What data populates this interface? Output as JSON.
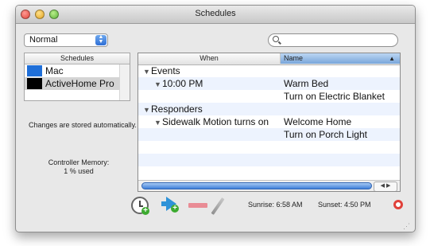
{
  "window": {
    "title": "Schedules"
  },
  "mode_popup": {
    "selected": "Normal"
  },
  "search": {
    "placeholder": ""
  },
  "schedules_panel": {
    "header": "Schedules",
    "items": [
      {
        "label": "Mac",
        "color": "#1f6fd8"
      },
      {
        "label": "ActiveHome Pro",
        "color": "#000000",
        "selected": true
      }
    ]
  },
  "notes": {
    "changes": "Changes are stored automatically.",
    "memory_label": "Controller Memory:",
    "memory_value": "1 % used"
  },
  "table": {
    "columns": {
      "when": "When",
      "name": "Name"
    },
    "rows": [
      {
        "when": "Events",
        "name": "",
        "group": true
      },
      {
        "when": "10:00 PM",
        "name": "Warm Bed"
      },
      {
        "when": "",
        "name": "Turn on Electric Blanket"
      },
      {
        "when": "Responders",
        "name": "",
        "group": true
      },
      {
        "when": "Sidewalk Motion turns on",
        "name": "Welcome Home"
      },
      {
        "when": "",
        "name": "Turn on Porch Light"
      }
    ]
  },
  "footer": {
    "sunrise": "Sunrise:  6:58 AM",
    "sunset": "Sunset:  4:50 PM"
  },
  "icons": {
    "add_timer": "clock-plus-icon",
    "add_trigger": "arrow-plus-icon",
    "remove": "minus-icon",
    "edit": "pencil-icon",
    "help": "lifebuoy-icon"
  }
}
